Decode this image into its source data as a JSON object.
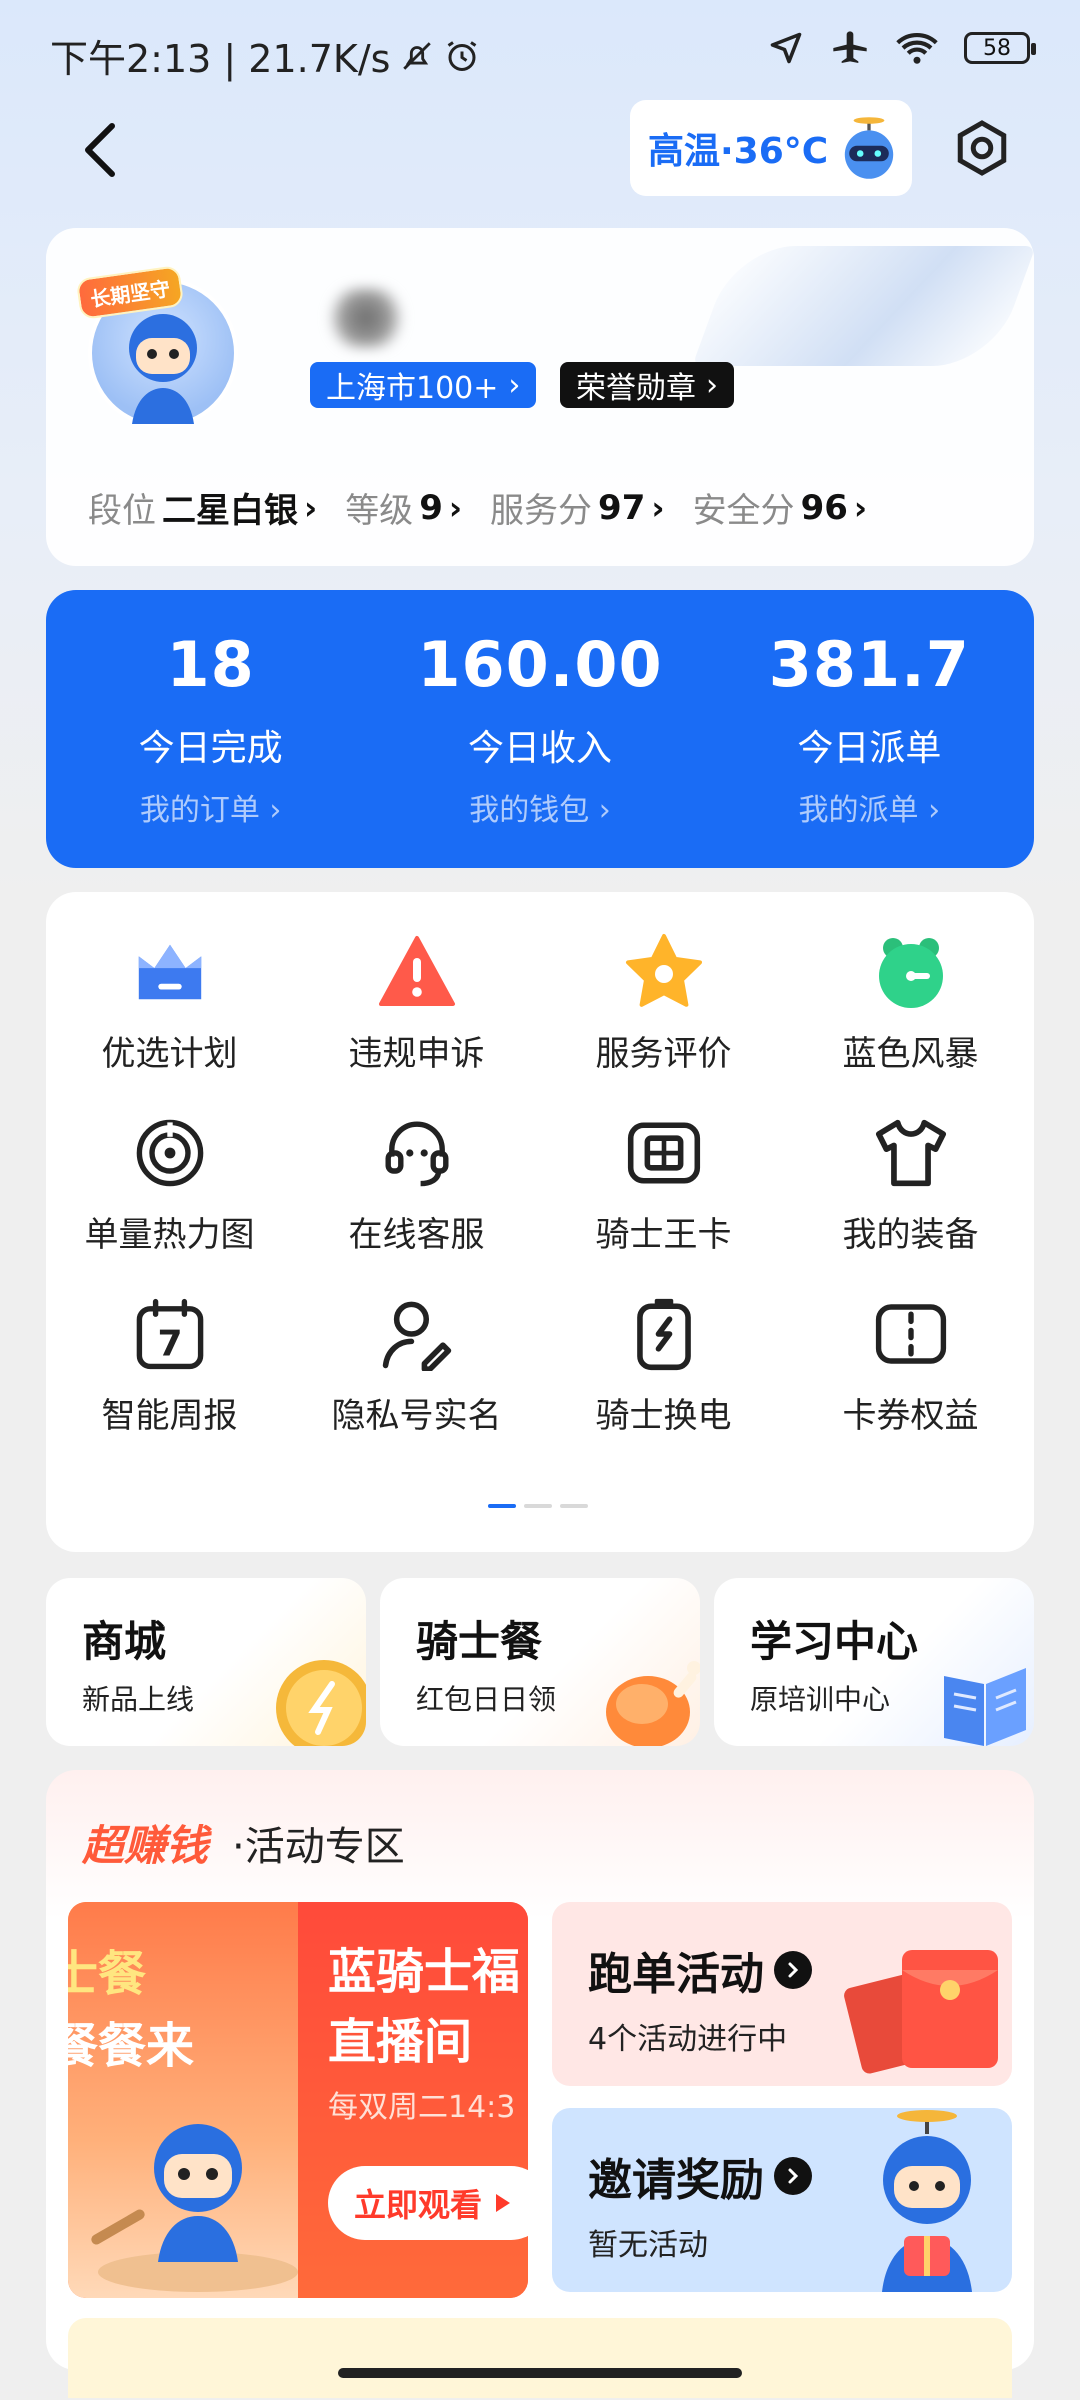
{
  "status_bar": {
    "time_speed": "下午2:13 | 21.7K/s",
    "battery": "58"
  },
  "header": {
    "weather": "高温·36°C"
  },
  "profile": {
    "avatar_badge": "长期坚守",
    "city_tag": "上海市100+",
    "honor_tag": "荣誉勋章",
    "stats": [
      {
        "label": "段位",
        "value": "二星白银"
      },
      {
        "label": "等级",
        "value": "9"
      },
      {
        "label": "服务分",
        "value": "97"
      },
      {
        "label": "安全分",
        "value": "96"
      }
    ]
  },
  "today": [
    {
      "number": "18",
      "label": "今日完成",
      "link": "我的订单"
    },
    {
      "number": "160.00",
      "label": "今日收入",
      "link": "我的钱包"
    },
    {
      "number": "381.7",
      "label": "今日派单",
      "link": "我的派单"
    }
  ],
  "tools": [
    {
      "label": "优选计划",
      "icon": "crown-icon"
    },
    {
      "label": "违规申诉",
      "icon": "warning-icon"
    },
    {
      "label": "服务评价",
      "icon": "star-icon"
    },
    {
      "label": "蓝色风暴",
      "icon": "clock-icon"
    },
    {
      "label": "单量热力图",
      "icon": "heatmap-icon"
    },
    {
      "label": "在线客服",
      "icon": "headset-icon"
    },
    {
      "label": "骑士王卡",
      "icon": "sim-card-icon"
    },
    {
      "label": "我的装备",
      "icon": "shirt-icon"
    },
    {
      "label": "智能周报",
      "icon": "calendar-icon"
    },
    {
      "label": "隐私号实名",
      "icon": "user-privacy-icon"
    },
    {
      "label": "骑士换电",
      "icon": "battery-swap-icon"
    },
    {
      "label": "卡券权益",
      "icon": "coupon-icon"
    }
  ],
  "shortcuts": [
    {
      "title": "商城",
      "sub": "新品上线"
    },
    {
      "title": "骑士餐",
      "sub": "红包日日领"
    },
    {
      "title": "学习中心",
      "sub": "原培训中心"
    }
  ],
  "activity": {
    "brand": "超赚钱",
    "title": "·活动专区",
    "banner": {
      "left_line1": "士餐",
      "left_line2": "餐餐来",
      "right_line1": "蓝骑士福",
      "right_line2": "直播间",
      "right_line3": "每双周二14:3",
      "button": "立即观看"
    },
    "tiles": [
      {
        "title": "跑单活动",
        "sub": "4个活动进行中"
      },
      {
        "title": "邀请奖励",
        "sub": "暂无活动"
      }
    ]
  },
  "colors": {
    "primary": "#1a6cf5",
    "activity_red": "#ff5a3a"
  }
}
